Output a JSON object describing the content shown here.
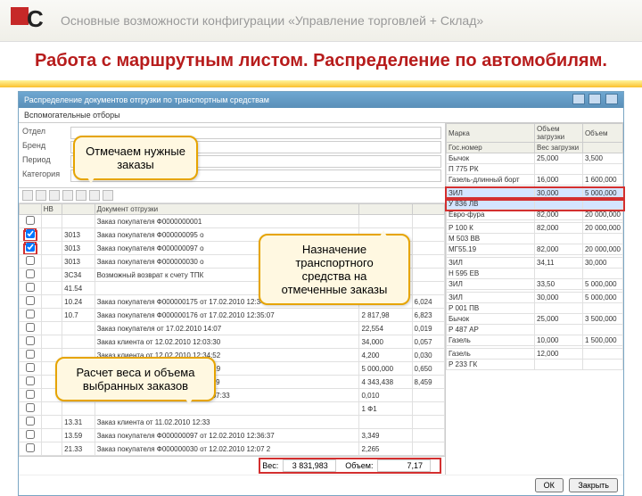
{
  "header": {
    "subtitle": "Основные возможности конфигурации «Управление торговлей + Склад»"
  },
  "title": "Работа с маршрутным листом. Распределение по автомобилям.",
  "window": {
    "title": "Распределение документов отгрузки по транспортным средствам"
  },
  "filters": {
    "section": "Вспомогательные отборы",
    "rows": [
      {
        "label": "Отдел",
        "value": ""
      },
      {
        "label": "Бренд",
        "value": ""
      },
      {
        "label": "Период",
        "value": ""
      },
      {
        "label": "Категория",
        "value": ""
      }
    ]
  },
  "grid": {
    "headers": [
      "",
      "НВ",
      "",
      "Документ отгрузки",
      "",
      ""
    ],
    "rows": [
      {
        "chk": false,
        "n": "",
        "code": "",
        "doc": "Заказ покупателя Ф0000000001",
        "v1": "",
        "v2": ""
      },
      {
        "chk": true,
        "n": "",
        "code": "3013",
        "doc": "Заказ покупателя Ф000000095 о",
        "v1": "",
        "v2": ""
      },
      {
        "chk": true,
        "n": "",
        "code": "3013",
        "doc": "Заказ покупателя Ф000000097 о",
        "v1": "",
        "v2": ""
      },
      {
        "chk": false,
        "n": "",
        "code": "3013",
        "doc": "Заказ покупателя Ф000000030 о",
        "v1": "",
        "v2": ""
      },
      {
        "chk": false,
        "n": "",
        "code": "3C34",
        "doc": "Возможный возврат к счету ТПК",
        "v1": "",
        "v2": ""
      },
      {
        "chk": false,
        "n": "",
        "code": "41.54",
        "doc": "",
        "v1": "",
        "v2": ""
      },
      {
        "chk": false,
        "n": "",
        "code": "10.24",
        "doc": "Заказ покупателя Ф000000175 от 17.02.2010 12:34:25",
        "v1": "3 481,00",
        "v2": "6,024"
      },
      {
        "chk": false,
        "n": "",
        "code": "10.7",
        "doc": "Заказ покупателя Ф000000176 от 17.02.2010 12:35:07",
        "v1": "2 817,98",
        "v2": "6,823"
      },
      {
        "chk": false,
        "n": "",
        "code": "",
        "doc": "Заказ покупателя от 17.02.2010 14:07",
        "v1": "22,554",
        "v2": "0,019"
      },
      {
        "chk": false,
        "n": "",
        "code": "",
        "doc": "Заказ клиента от 12.02.2010 12:03:30",
        "v1": "34,000",
        "v2": "0,057"
      },
      {
        "chk": false,
        "n": "",
        "code": "",
        "doc": "Заказ клиента от 12.02.2010 12:34:52",
        "v1": "4,200",
        "v2": "0,030"
      },
      {
        "chk": false,
        "n": "",
        "code": "",
        "doc": "Заказ клиента от 12.02.2010 12:37:19",
        "v1": "5 000,000",
        "v2": "0,650"
      },
      {
        "chk": false,
        "n": "",
        "code": "",
        "doc": "Заказ клиента от 17.02.2010 11:07:19",
        "v1": "4 343,438",
        "v2": "8,459"
      },
      {
        "chk": false,
        "n": "",
        "code": "",
        "doc": "Заказ клиента от 17.02.2010 11:16:07:33",
        "v1": "0,010",
        "v2": ""
      },
      {
        "chk": false,
        "n": "",
        "code": "",
        "doc": "",
        "v1": "1 Ф1",
        "v2": ""
      },
      {
        "chk": false,
        "n": "",
        "code": "13.31",
        "doc": "Заказ клиента от 11.02.2010 12:33",
        "v1": "",
        "v2": ""
      },
      {
        "chk": false,
        "n": "",
        "code": "13.59",
        "doc": "Заказ покупателя Ф000000097 от 12.02.2010 12:36:37",
        "v1": "3,349",
        "v2": ""
      },
      {
        "chk": false,
        "n": "",
        "code": "21.33",
        "doc": "Заказ покупателя Ф000000030 от 12.02.2010 12:07 2",
        "v1": "2,265",
        "v2": ""
      }
    ]
  },
  "vehicles": {
    "headers": [
      "Марка",
      "Объем загрузки",
      "Объем"
    ],
    "sub": [
      "Гос.номер",
      "Вес загрузки",
      ""
    ],
    "rows": [
      {
        "marka": "Бычок",
        "gos": "П 775 РК",
        "v1": "25,000",
        "v2": "3,500"
      },
      {
        "marka": "Газель-длинный борт",
        "gos": "",
        "v1": "16,000",
        "v2": "1 600,000"
      },
      {
        "marka": "ЗИЛ",
        "gos": "У 836 ЛВ",
        "v1": "30,000",
        "v2": "5 000,000",
        "sel": true
      },
      {
        "marka": "Евро-фура",
        "gos": "",
        "v1": "82,000",
        "v2": "20 000,000"
      },
      {
        "marka": "Р 100 К",
        "gos": "М 503 ВВ",
        "v1": "82,000",
        "v2": "20 000,000"
      },
      {
        "marka": "МГ55.19",
        "gos": "",
        "v1": "82,000",
        "v2": "20 000,000"
      },
      {
        "marka": "ЗИЛ",
        "gos": "Н 595 ЕВ",
        "v1": "34,11",
        "v2": "30,000"
      },
      {
        "marka": "ЗИЛ",
        "gos": "",
        "v1": "33,50",
        "v2": "5 000,000"
      },
      {
        "marka": "ЗИЛ",
        "gos": "Р 001 ПВ",
        "v1": "30,000",
        "v2": "5 000,000"
      },
      {
        "marka": "Бычок",
        "gos": "Р 487 АР",
        "v1": "25,000",
        "v2": "3 500,000"
      },
      {
        "marka": "Газель",
        "gos": "",
        "v1": "10,000",
        "v2": "1 500,000"
      },
      {
        "marka": "Газель",
        "gos": "Р 233 ГК",
        "v1": "12,000",
        "v2": ""
      }
    ]
  },
  "footer": {
    "weight_label": "Вес:",
    "weight": "3 831,983",
    "vol_label": "Объем:",
    "vol": "7,17"
  },
  "buttons": {
    "ok": "ОК",
    "close": "Закрыть"
  },
  "callouts": {
    "c1": "Отмечаем нужные заказы",
    "c2": "Назначение транспортного средства на отмеченные заказы",
    "c3": "Расчет веса и объема выбранных заказов"
  }
}
